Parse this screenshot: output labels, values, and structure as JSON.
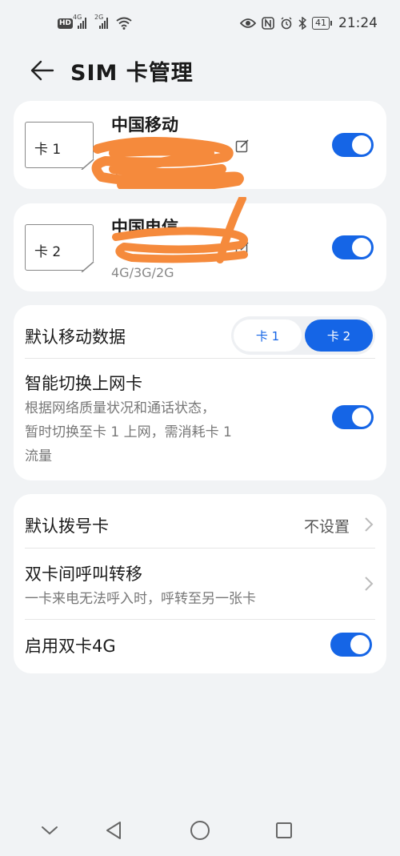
{
  "status_bar": {
    "hd_badge": "HD",
    "sim1_tag": "4G",
    "sim2_tag": "2G",
    "battery": "41",
    "time": "21:24"
  },
  "header": {
    "title": "SIM 卡管理"
  },
  "sim_cards": [
    {
      "label": "卡 1",
      "carrier": "中国移动",
      "number_visible_suffix": "5",
      "network": "4G",
      "enabled": true
    },
    {
      "label": "卡 2",
      "carrier": "中国电信",
      "number_visible_suffix": "",
      "network": "4G/3G/2G",
      "enabled": true
    }
  ],
  "default_data": {
    "title": "默认移动数据",
    "options": [
      "卡 1",
      "卡 2"
    ],
    "selected": "卡 2"
  },
  "smart_switch": {
    "title": "智能切换上网卡",
    "desc_line1": "根据网络质量状况和通话状态，",
    "desc_line2": "暂时切换至卡 1 上网，需消耗卡 1",
    "desc_line3": "流量",
    "enabled": true
  },
  "call_settings": {
    "default_dial_title": "默认拨号卡",
    "default_dial_value": "不设置",
    "forward_title": "双卡间呼叫转移",
    "forward_desc": "一卡来电无法呼入时，呼转至另一张卡",
    "dual_4g_title": "启用双卡4G",
    "dual_4g_enabled": true
  },
  "colors": {
    "accent": "#1565e6",
    "background": "#f1f3f5",
    "scribble": "#f58a3c"
  }
}
